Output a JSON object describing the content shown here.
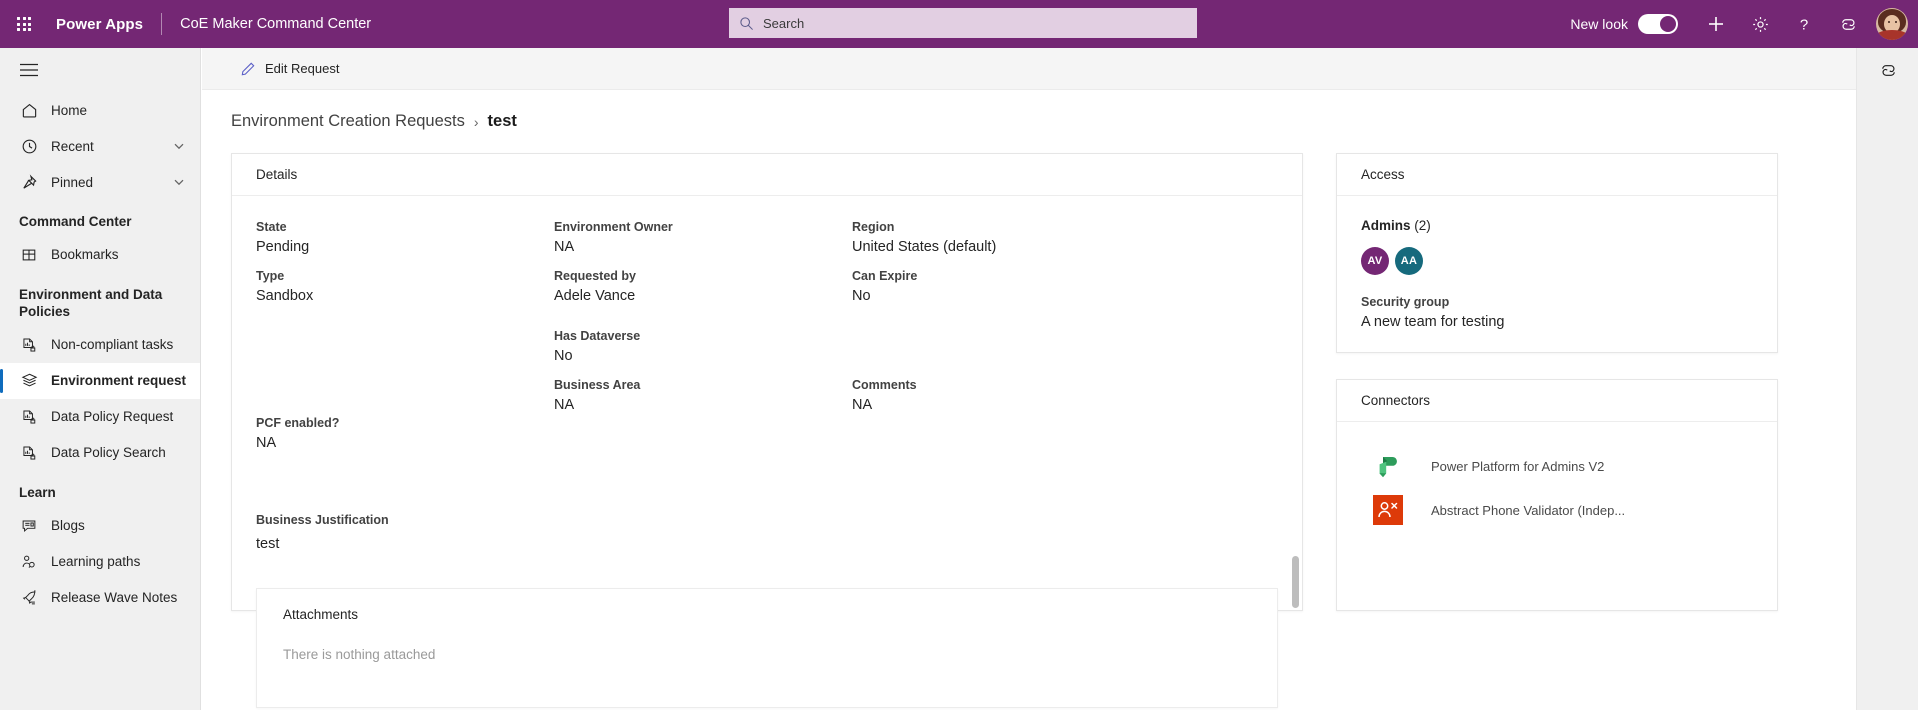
{
  "header": {
    "waffle_icon": "app-launcher-icon",
    "brand": "Power Apps",
    "app_name": "CoE Maker Command Center",
    "search_placeholder": "Search",
    "search_value": "",
    "new_look_label": "New look",
    "new_look_on": true,
    "icons": [
      "plus-icon",
      "gear-icon",
      "help-icon",
      "copilot-icon"
    ],
    "accent_color": "#742774"
  },
  "sidebar": {
    "hamburger": "hamburger-icon",
    "items": [
      {
        "label": "Home",
        "icon": "home-icon",
        "expandable": false,
        "selected": false
      },
      {
        "label": "Recent",
        "icon": "clock-icon",
        "expandable": true,
        "selected": false
      },
      {
        "label": "Pinned",
        "icon": "pin-icon",
        "expandable": true,
        "selected": false
      }
    ],
    "groups": [
      {
        "title": "Command Center",
        "items": [
          {
            "label": "Bookmarks",
            "icon": "bookmark-grid-icon",
            "selected": false
          }
        ]
      },
      {
        "title": "Environment and Data Policies",
        "items": [
          {
            "label": "Non-compliant tasks",
            "icon": "report-lock-icon",
            "selected": false
          },
          {
            "label": "Environment request",
            "icon": "layers-icon",
            "selected": true
          },
          {
            "label": "Data Policy Request",
            "icon": "report-lock-icon",
            "selected": false
          },
          {
            "label": "Data Policy Search",
            "icon": "report-lock-icon",
            "selected": false
          }
        ]
      },
      {
        "title": "Learn",
        "items": [
          {
            "label": "Blogs",
            "icon": "blog-icon",
            "selected": false
          },
          {
            "label": "Learning paths",
            "icon": "person-path-icon",
            "selected": false
          },
          {
            "label": "Release Wave Notes",
            "icon": "rocket-icon",
            "selected": false
          }
        ]
      }
    ],
    "selection_indicator_color": "#0f6cbd"
  },
  "command_bar": {
    "edit_request_label": "Edit Request",
    "edit_icon": "pencil-icon"
  },
  "breadcrumb": {
    "parent": "Environment Creation Requests",
    "separator": "›",
    "current": "test"
  },
  "details": {
    "title": "Details",
    "fields": [
      {
        "label": "State",
        "value": "Pending"
      },
      {
        "label": "Type",
        "value": "Sandbox"
      },
      {
        "label": "PCF enabled?",
        "value": "NA"
      },
      {
        "label": "Business Justification",
        "value": "test"
      },
      {
        "label": "Environment Owner",
        "value": "NA"
      },
      {
        "label": "Requested by",
        "value": "Adele Vance"
      },
      {
        "label": "Has Dataverse",
        "value": "No"
      },
      {
        "label": "Business Area",
        "value": "NA"
      },
      {
        "label": "Region",
        "value": "United States (default)"
      },
      {
        "label": "Can Expire",
        "value": "No"
      },
      {
        "label": "Comments",
        "value": "NA"
      }
    ],
    "attachments": {
      "title": "Attachments",
      "empty_text": "There is nothing attached"
    }
  },
  "access": {
    "title": "Access",
    "admins_label": "Admins",
    "admins_count": "(2)",
    "admins": [
      {
        "initials": "AV",
        "color": "#742774"
      },
      {
        "initials": "AA",
        "color": "#166a7d"
      }
    ],
    "security_group_label": "Security group",
    "security_group_value": "A new team for testing"
  },
  "connectors": {
    "title": "Connectors",
    "items": [
      {
        "name": "Power Platform for Admins V2",
        "icon": "power-platform-icon",
        "color": "#1a9e5f"
      },
      {
        "name": "Abstract Phone Validator (Indep...",
        "icon": "abstract-phone-validator-icon",
        "color": "#dd3a09"
      }
    ]
  },
  "right_rail": {
    "copilot_icon": "copilot-icon"
  }
}
